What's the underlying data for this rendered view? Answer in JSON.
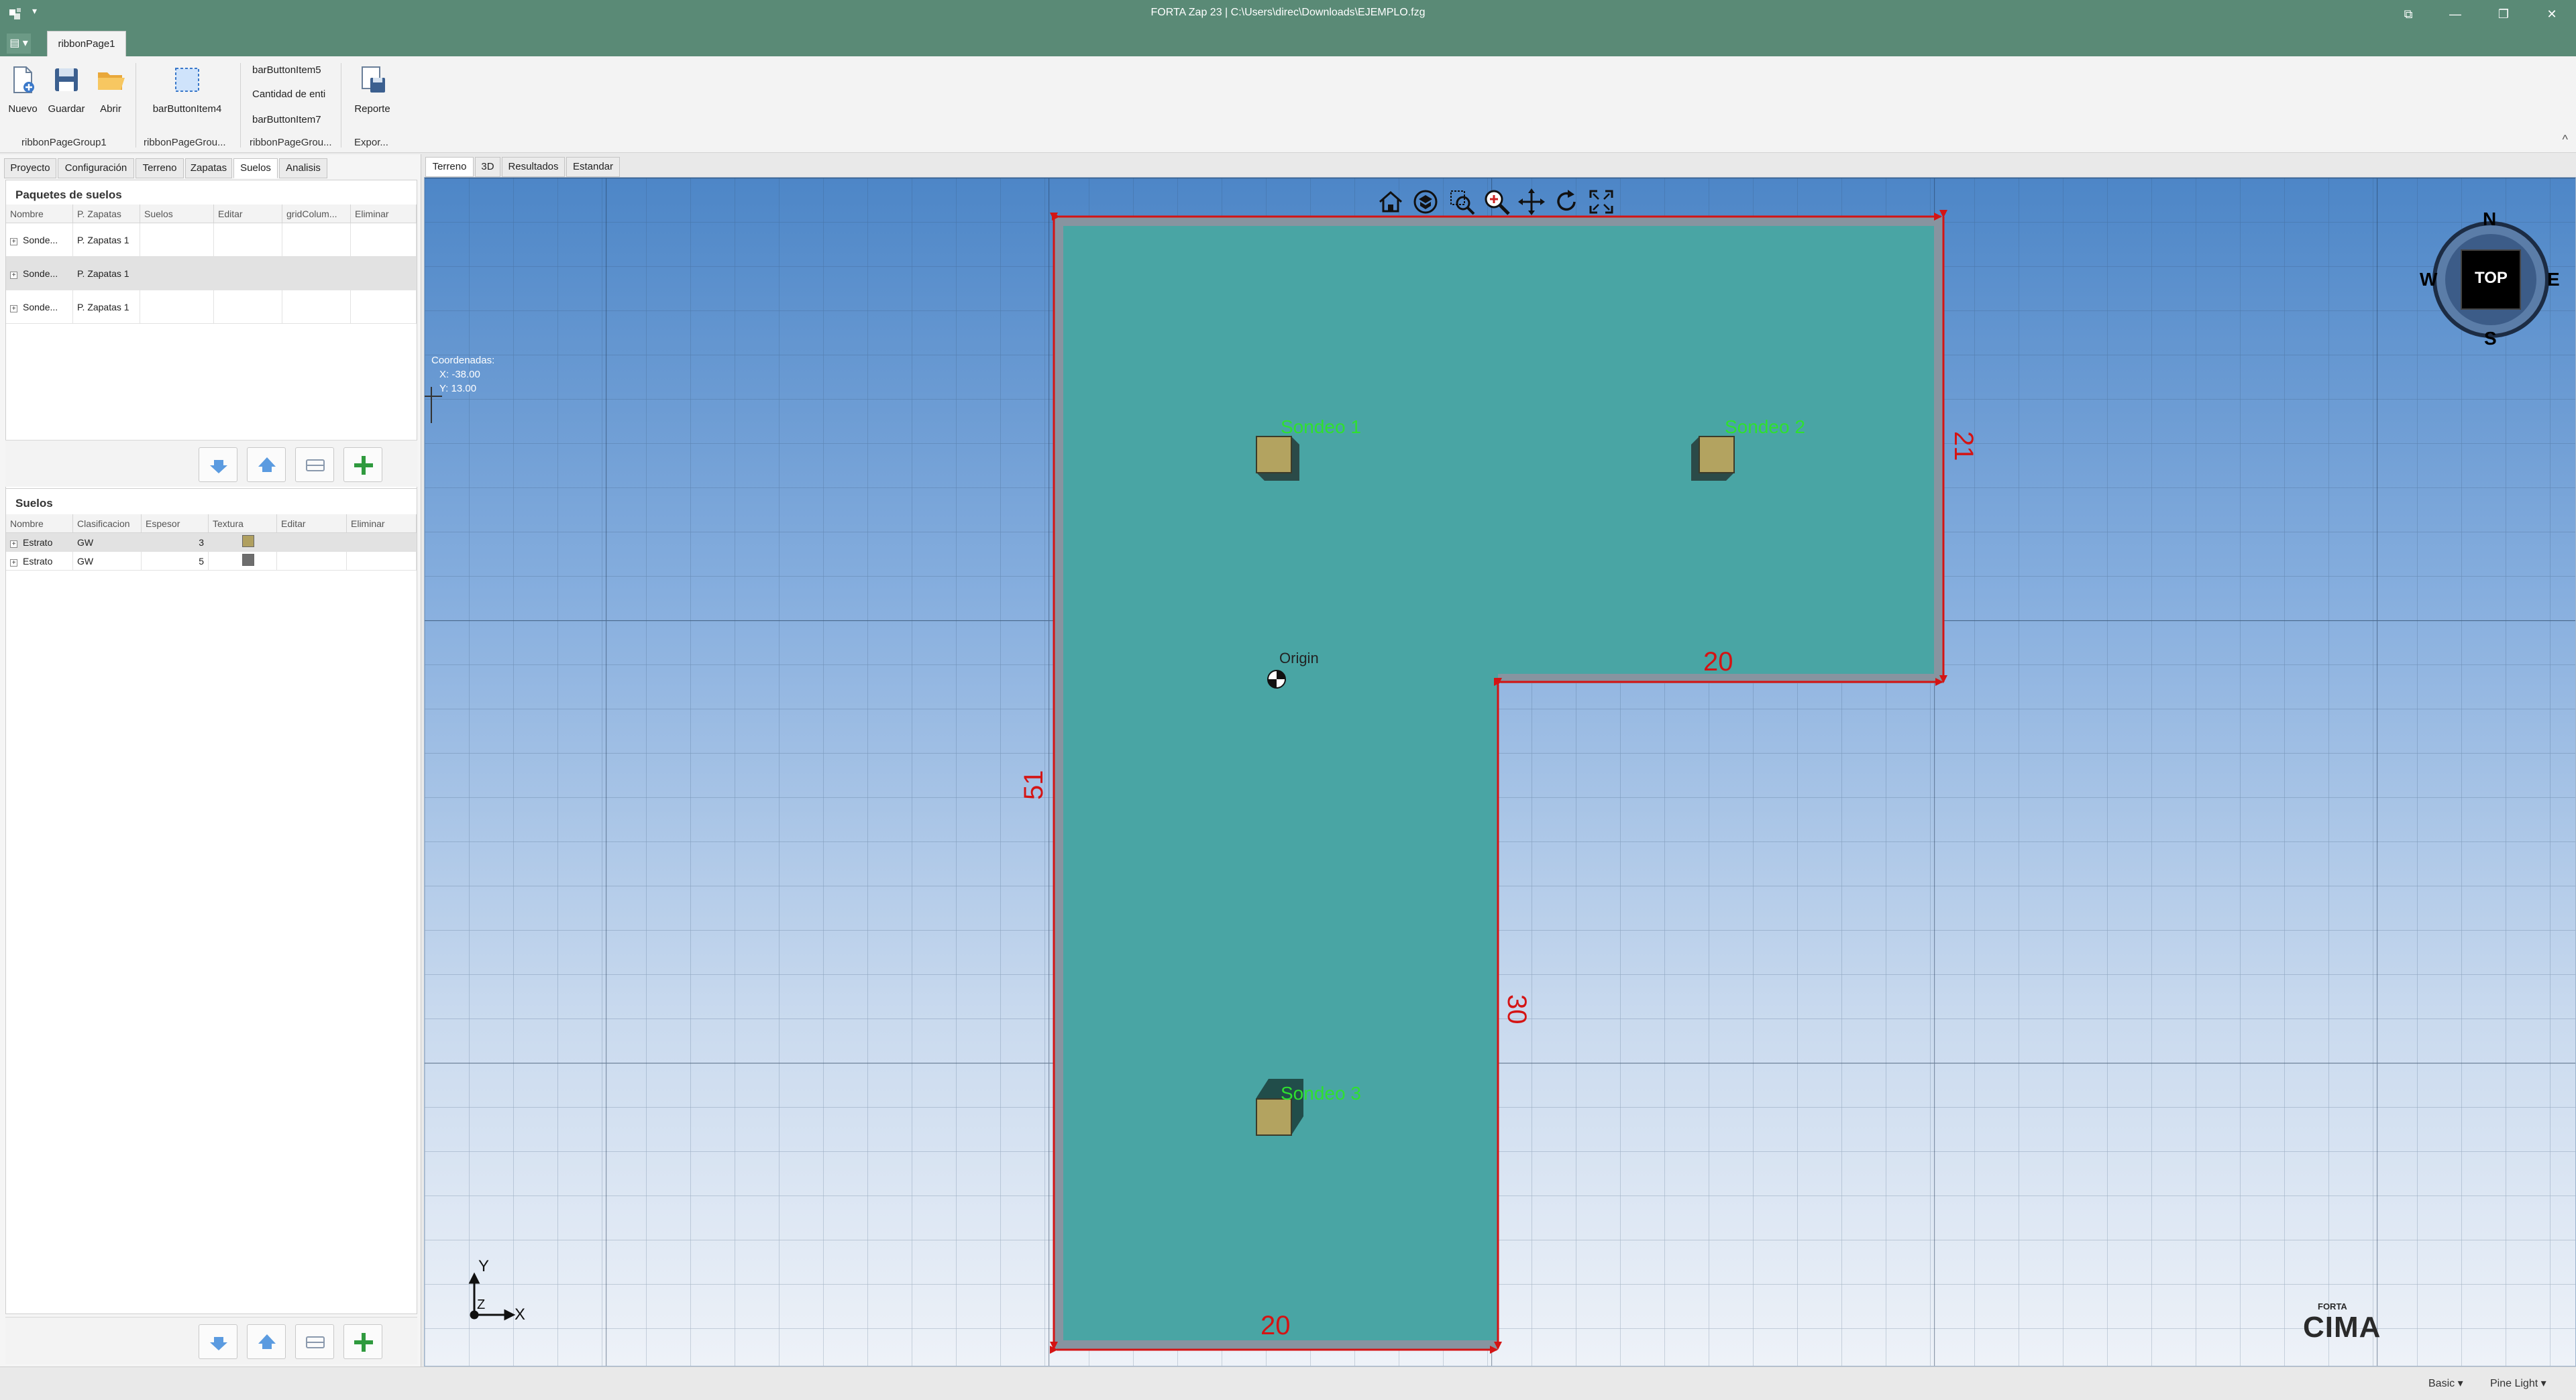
{
  "window": {
    "title": "FORTA Zap 23 | C:\\Users\\direc\\Downloads\\EJEMPLO.fzg",
    "quick_access": "▾",
    "controls": [
      "⧉",
      "—",
      "❐",
      "✕"
    ]
  },
  "ribbon": {
    "app_menu": "▤ ▾",
    "tab": "ribbonPage1",
    "buttons": {
      "nuevo": "Nuevo",
      "guardar": "Guardar",
      "abrir": "Abrir",
      "item4": "barButtonItem4",
      "item5": "barButtonItem5",
      "cantidad": "Cantidad de enti",
      "item7": "barButtonItem7",
      "reporte": "Reporte"
    },
    "groups": [
      "ribbonPageGroup1",
      "ribbonPageGrou...",
      "ribbonPageGrou...",
      "Expor..."
    ],
    "collapse": "^"
  },
  "left_tabs": [
    "Proyecto",
    "Configuración",
    "Terreno",
    "Zapatas",
    "Suelos",
    "Analisis"
  ],
  "paquetes": {
    "title": "Paquetes de suelos",
    "columns": [
      "Nombre",
      "P. Zapatas",
      "Suelos",
      "Editar",
      "gridColum...",
      "Eliminar"
    ],
    "rows": [
      {
        "nombre": "Sonde...",
        "zapatas": "P. Zapatas 1"
      },
      {
        "nombre": "Sonde...",
        "zapatas": "P. Zapatas 1"
      },
      {
        "nombre": "Sonde...",
        "zapatas": "P. Zapatas 1"
      }
    ]
  },
  "suelos": {
    "title": "Suelos",
    "columns": [
      "Nombre",
      "Clasificacion",
      "Espesor",
      "Textura",
      "Editar",
      "Eliminar"
    ],
    "rows": [
      {
        "nombre": "Estrato",
        "clasificacion": "GW",
        "espesor": "3",
        "color": "#b0a060"
      },
      {
        "nombre": "Estrato",
        "clasificacion": "GW",
        "espesor": "5",
        "color": "#6e6e6e"
      }
    ]
  },
  "view_tabs": [
    "Terreno",
    "3D",
    "Resultados",
    "Estandar"
  ],
  "viewport": {
    "coords_title": "Coordenadas:",
    "coord_x": "X: -38.00",
    "coord_y": "Y: 13.00",
    "sondeos": [
      "Sondeo 1",
      "Sondeo 2",
      "Sondeo 3"
    ],
    "origin_label": "Origin",
    "dimensions": {
      "top_right_width": "20",
      "right_height": "21",
      "left_height": "51",
      "inner_height": "30",
      "bottom_width": "20"
    },
    "compass": {
      "n": "N",
      "s": "S",
      "e": "E",
      "w": "W",
      "center": "TOP"
    },
    "axes": {
      "x": "X",
      "y": "Y",
      "z": "Z"
    },
    "logo_top": "FORTA",
    "logo": "CIMA",
    "colors": {
      "terrain": "#3ea8a4",
      "dimension": "#d41414",
      "label": "#2fe02f",
      "sondeo_top": "#b3a360"
    }
  },
  "status": {
    "left": "Basic ▾",
    "right": "Pine Light ▾"
  }
}
